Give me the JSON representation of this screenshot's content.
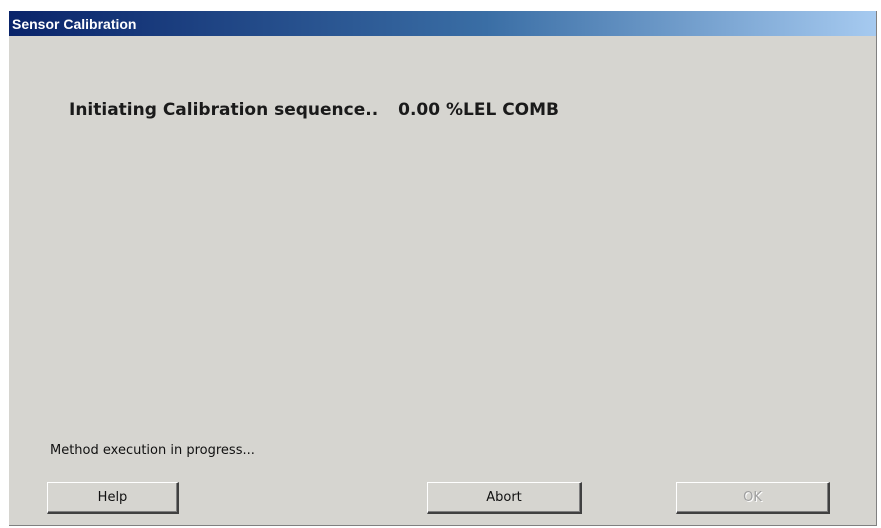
{
  "window": {
    "title": "Sensor Calibration"
  },
  "message": {
    "sequence_text": "Initiating Calibration sequence..",
    "reading": "0.00 %LEL COMB"
  },
  "status": {
    "text": "Method execution in progress..."
  },
  "buttons": {
    "help": "Help",
    "abort": "Abort",
    "ok": "OK"
  },
  "colors": {
    "titlebar_start": "#0a246a",
    "titlebar_end": "#a6caf0",
    "dialog_bg": "#d6d5d0",
    "disabled_text": "#a0a0a0"
  }
}
